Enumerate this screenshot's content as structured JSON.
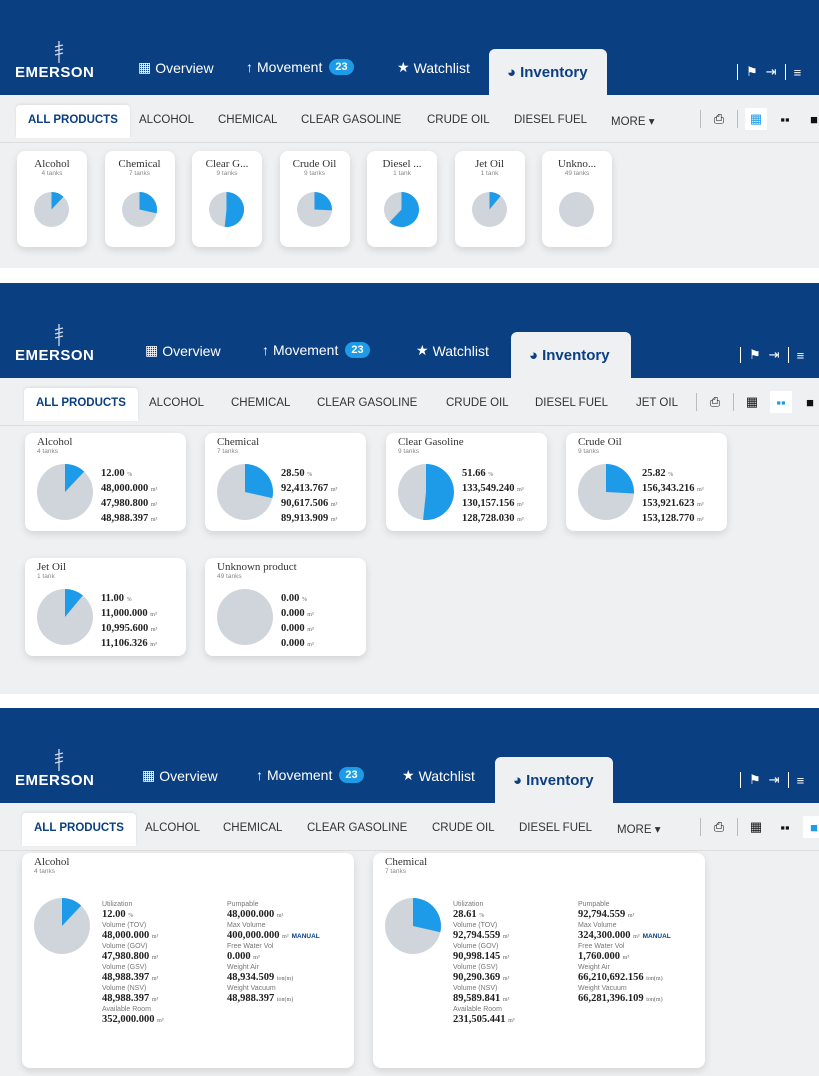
{
  "nav": {
    "logo": "EMERSON",
    "overview": "Overview",
    "movement": "Movement",
    "movement_count": "23",
    "watchlist": "Watchlist",
    "inventory": "Inventory"
  },
  "tabs": {
    "all": "ALL PRODUCTS",
    "alcohol": "ALCOHOL",
    "chemical": "CHEMICAL",
    "clear_gasoline": "CLEAR GASOLINE",
    "crude_oil": "CRUDE OIL",
    "diesel_fuel": "DIESEL FUEL",
    "jet_oil": "JET OIL",
    "more": "MORE ▾"
  },
  "compact_cards": [
    {
      "name": "Alcohol",
      "tanks": "4 tanks",
      "fraction": 0.12
    },
    {
      "name": "Chemical",
      "tanks": "7 tanks",
      "fraction": 0.285
    },
    {
      "name": "Clear G...",
      "tanks": "9 tanks",
      "fraction": 0.5166
    },
    {
      "name": "Crude Oil",
      "tanks": "9 tanks",
      "fraction": 0.2582
    },
    {
      "name": "Diesel ...",
      "tanks": "1 tank",
      "fraction": 0.62
    },
    {
      "name": "Jet Oil",
      "tanks": "1 tank",
      "fraction": 0.11
    },
    {
      "name": "Unkno...",
      "tanks": "49 tanks",
      "fraction": 0
    }
  ],
  "medium_cards": [
    {
      "name": "Alcohol",
      "tanks": "4 tanks",
      "fraction": 0.12,
      "util": "12.00",
      "v1": "48,000.000",
      "v2": "47,980.800",
      "v3": "48,988.397"
    },
    {
      "name": "Chemical",
      "tanks": "7 tanks",
      "fraction": 0.285,
      "util": "28.50",
      "v1": "92,413.767",
      "v2": "90,617.506",
      "v3": "89,913.909"
    },
    {
      "name": "Clear Gasoline",
      "tanks": "9 tanks",
      "fraction": 0.5166,
      "util": "51.66",
      "v1": "133,549.240",
      "v2": "130,157.156",
      "v3": "128,728.030"
    },
    {
      "name": "Crude Oil",
      "tanks": "9 tanks",
      "fraction": 0.2582,
      "util": "25.82",
      "v1": "156,343.216",
      "v2": "153,921.623",
      "v3": "153,128.770"
    },
    {
      "name": "Jet Oil",
      "tanks": "1 tank",
      "fraction": 0.11,
      "util": "11.00",
      "v1": "11,000.000",
      "v2": "10,995.600",
      "v3": "11,106.326"
    },
    {
      "name": "Unknown product",
      "tanks": "49 tanks",
      "fraction": 0,
      "util": "0.00",
      "v1": "0.000",
      "v2": "0.000",
      "v3": "0.000"
    }
  ],
  "units": {
    "pct": "%",
    "m3": "m³",
    "ton": "ton(m)"
  },
  "labels": {
    "utilization": "Utilization",
    "tov": "Volume (TOV)",
    "gov": "Volume (GOV)",
    "gsv": "Volume (GSV)",
    "nsv": "Volume (NSV)",
    "available": "Available Room",
    "pumpable": "Pumpable",
    "max_volume": "Max Volume",
    "free_water": "Free Water Vol",
    "weight_air": "Weight Air",
    "weight_vacuum": "Weight Vacuum",
    "manual": "MANUAL"
  },
  "detail_cards": [
    {
      "name": "Alcohol",
      "tanks": "4 tanks",
      "fraction": 0.12,
      "util": "12.00",
      "tov": "48,000.000",
      "gov": "47,980.800",
      "gsv": "48,988.397",
      "nsv": "48,988.397",
      "available": "352,000.000",
      "pumpable": "48,000.000",
      "max_volume": "400,000.000",
      "free_water": "0.000",
      "weight_air": "48,934.509",
      "weight_vacuum": "48,988.397"
    },
    {
      "name": "Chemical",
      "tanks": "7 tanks",
      "fraction": 0.2861,
      "util": "28.61",
      "tov": "92,794.559",
      "gov": "90,998.145",
      "gsv": "90,290.369",
      "nsv": "89,589.841",
      "available": "231,505.441",
      "pumpable": "92,794.559",
      "max_volume": "324,300.000",
      "free_water": "1,760.000",
      "weight_air": "66,210,692.156",
      "weight_vacuum": "66,281,396.109"
    }
  ],
  "colors": {
    "navy": "#0a3f82",
    "accent": "#1e9be8",
    "pie_bg": "#cfd5db"
  }
}
